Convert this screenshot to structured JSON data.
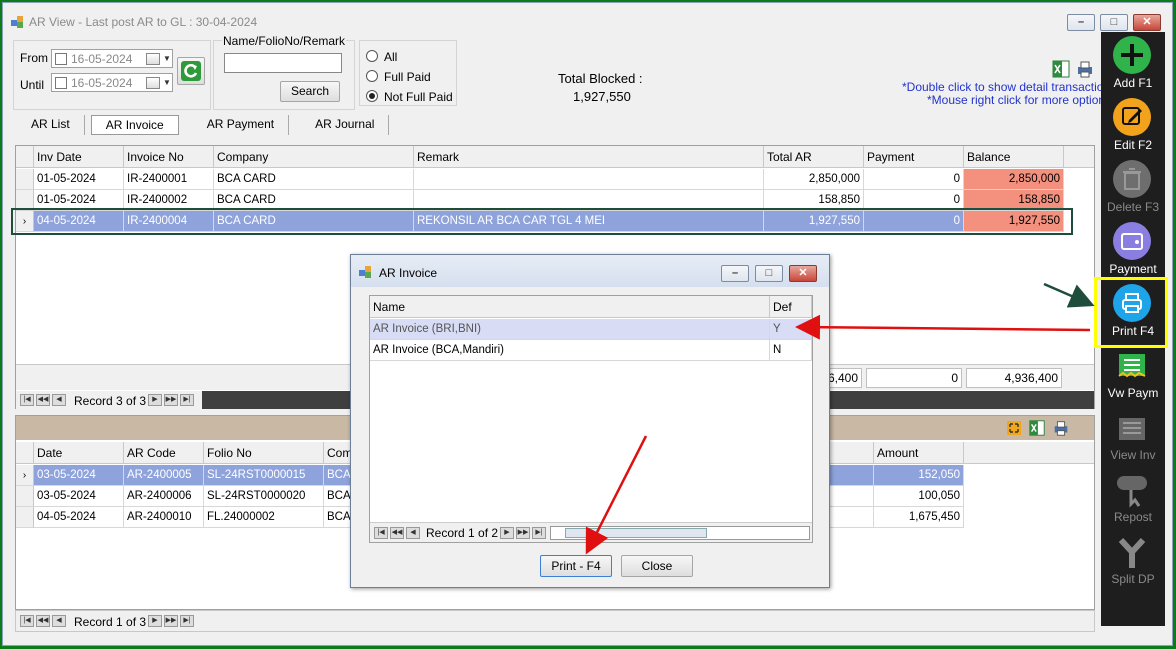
{
  "window": {
    "title": "AR View - Last post AR to GL : 30-04-2024",
    "controls": {
      "minimize": "–",
      "maximize": "□",
      "close": "✕"
    }
  },
  "filter": {
    "from_label": "From",
    "until_label": "Until",
    "from_date": "16-05-2024",
    "until_date": "16-05-2024",
    "name_label": "Name/FolioNo/Remark",
    "name_value": "",
    "search_label": "Search",
    "status_options": [
      "All",
      "Full Paid",
      "Not Full Paid"
    ],
    "status_selected": "Not Full Paid"
  },
  "summary": {
    "blocked_label": "Total Blocked :",
    "blocked_value": "1,927,550"
  },
  "hints": {
    "line1": "*Double click to show detail transaction",
    "line2": "*Mouse right click for more options"
  },
  "tabs": [
    "AR List",
    "AR Invoice",
    "AR Payment",
    "AR Journal"
  ],
  "active_tab": "AR Invoice",
  "invoice_grid": {
    "columns": [
      "Inv Date",
      "Invoice No",
      "Company",
      "Remark",
      "Total AR",
      "Payment",
      "Balance"
    ],
    "rows": [
      [
        "01-05-2024",
        "IR-2400001",
        "BCA CARD",
        "",
        "2,850,000",
        "0",
        "2,850,000"
      ],
      [
        "01-05-2024",
        "IR-2400002",
        "BCA CARD",
        "",
        "158,850",
        "0",
        "158,850"
      ],
      [
        "04-05-2024",
        "IR-2400004",
        "BCA CARD",
        "REKONSIL AR BCA CAR TGL 4 MEI",
        "1,927,550",
        "0",
        "1,927,550"
      ]
    ],
    "selected_row": 2,
    "totals": {
      "total_ar_partial": "6,400",
      "payment": "0",
      "balance": "4,936,400"
    },
    "record_text": "Record 3 of 3"
  },
  "payment_grid": {
    "columns": [
      "Date",
      "AR Code",
      "Folio No",
      "Comp",
      "Amount"
    ],
    "rows": [
      [
        "03-05-2024",
        "AR-2400005",
        "SL-24RST0000015",
        "BCA C",
        "152,050"
      ],
      [
        "03-05-2024",
        "AR-2400006",
        "SL-24RST0000020",
        "BCA C",
        "100,050"
      ],
      [
        "04-05-2024",
        "AR-2400010",
        "FL.24000002",
        "BCA C",
        "1,675,450"
      ]
    ],
    "selected_row": 0,
    "record_text": "Record 1 of 3"
  },
  "toolbar": [
    {
      "label": "Add F1",
      "icon": "plus-icon",
      "color": "#2fb34a",
      "enabled": true
    },
    {
      "label": "Edit F2",
      "icon": "pencil-icon",
      "color": "#f2a31b",
      "enabled": true
    },
    {
      "label": "Delete F3",
      "icon": "trash-icon",
      "color": "#6e6e6e",
      "enabled": false
    },
    {
      "label": "Payment",
      "icon": "wallet-icon",
      "color": "#8a7ee0",
      "enabled": true
    },
    {
      "label": "Print F4",
      "icon": "printer-icon",
      "color": "#1ea4e8",
      "enabled": true
    },
    {
      "label": "Vw Paym",
      "icon": "receipt-icon",
      "color": "#2fb34a",
      "enabled": true
    },
    {
      "label": "View Inv",
      "icon": "building-icon",
      "color": "#6e6e6e",
      "enabled": false
    },
    {
      "label": "Repost",
      "icon": "post-icon",
      "color": "#6e6e6e",
      "enabled": false
    },
    {
      "label": "Split DP",
      "icon": "split-icon",
      "color": "#6e6e6e",
      "enabled": false
    }
  ],
  "dialog": {
    "title": "AR Invoice",
    "columns": [
      "Name",
      "Def"
    ],
    "rows": [
      [
        "AR Invoice (BRI,BNI)",
        "Y"
      ],
      [
        "AR Invoice (BCA,Mandiri)",
        "N"
      ]
    ],
    "selected_row": 0,
    "record_text": "Record 1 of 2",
    "print_label": "Print - F4",
    "close_label": "Close"
  },
  "colors": {
    "highlight": "#ffff00",
    "annotation_arrow": "#e01010",
    "selection": "#8ea3dc",
    "balance": "#f4907e"
  }
}
